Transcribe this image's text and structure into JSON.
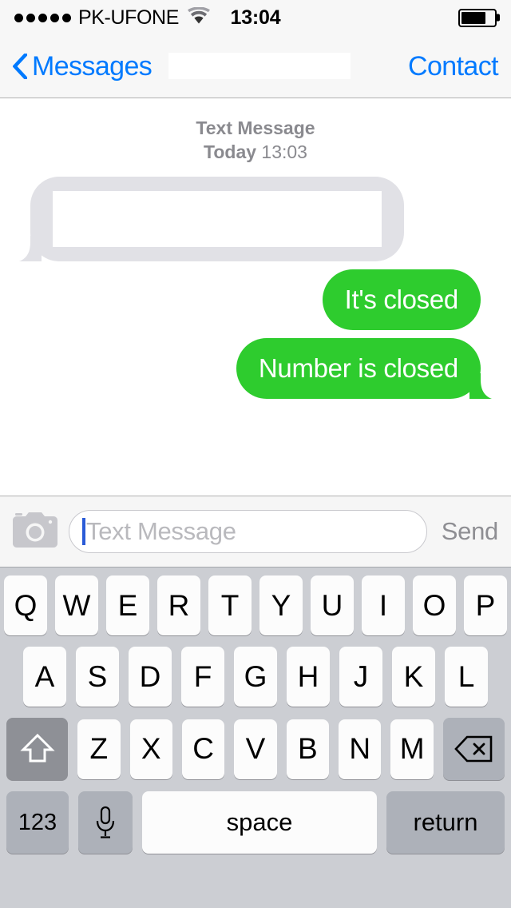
{
  "status_bar": {
    "signal_dots_filled": 5,
    "signal_dots_total": 5,
    "carrier": "PK-UFONE",
    "wifi_icon": "wifi-icon",
    "time": "13:04",
    "battery_icon": "battery-icon",
    "battery_level_pct": 75
  },
  "nav_bar": {
    "back_icon": "chevron-left-icon",
    "back_label": "Messages",
    "title_redacted": true,
    "right_label": "Contact",
    "accent_color": "#007aff"
  },
  "conversation": {
    "meta_type": "Text Message",
    "meta_day": "Today",
    "meta_time": "13:03",
    "messages": [
      {
        "direction": "incoming",
        "text": "",
        "redacted": true,
        "bubble_color": "#e1e1e6"
      },
      {
        "direction": "outgoing",
        "text": "It's closed",
        "redacted": false,
        "bubble_color": "#2ecc2e"
      },
      {
        "direction": "outgoing",
        "text": "Number is closed",
        "redacted": false,
        "bubble_color": "#2ecc2e"
      }
    ]
  },
  "toolbar": {
    "camera_icon": "camera-icon",
    "input_placeholder": "Text Message",
    "input_value": "",
    "send_label": "Send",
    "send_enabled": false
  },
  "keyboard": {
    "row1": [
      "Q",
      "W",
      "E",
      "R",
      "T",
      "Y",
      "U",
      "I",
      "O",
      "P"
    ],
    "row2": [
      "A",
      "S",
      "D",
      "F",
      "G",
      "H",
      "J",
      "K",
      "L"
    ],
    "row3_letters": [
      "Z",
      "X",
      "C",
      "V",
      "B",
      "N",
      "M"
    ],
    "shift_icon": "shift-arrow-icon",
    "backspace_icon": "backspace-icon",
    "numbers_label": "123",
    "mic_icon": "microphone-icon",
    "space_label": "space",
    "return_label": "return"
  }
}
